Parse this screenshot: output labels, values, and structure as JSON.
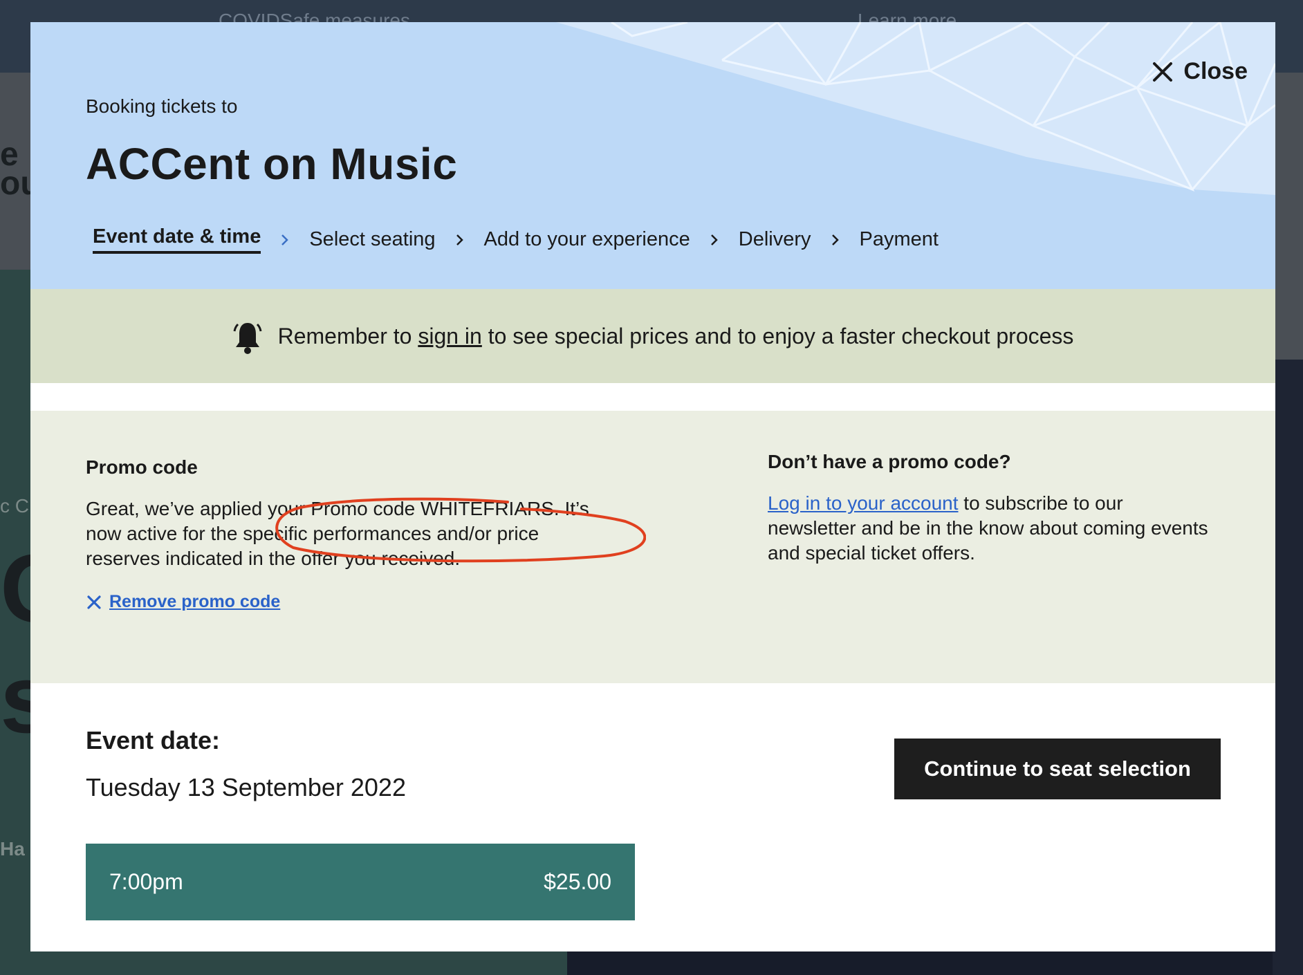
{
  "background": {
    "topbar_left": "COVIDSafe measures",
    "topbar_right": "Learn more",
    "fragment_1": "e",
    "fragment_2": "ou",
    "fragment_3": "c C",
    "fragment_4": "C",
    "fragment_5": "si",
    "fragment_6": "Ha"
  },
  "modal": {
    "close_label": "Close",
    "booking_label": "Booking tickets to",
    "event_title": "ACCent on Music",
    "steps": [
      {
        "label": "Event date & time",
        "active": true
      },
      {
        "label": "Select seating",
        "active": false
      },
      {
        "label": "Add to your experience",
        "active": false
      },
      {
        "label": "Delivery",
        "active": false
      },
      {
        "label": "Payment",
        "active": false
      }
    ],
    "signin_bar": {
      "prefix": "Remember to",
      "link": "sign in",
      "suffix": "to see special prices and to enjoy a faster checkout process",
      "icon": "bell-icon"
    },
    "promo": {
      "heading": "Promo code",
      "message": "Great, we’ve applied your Promo code WHITEFRIARS. It’s now active for the specific performances and/or price reserves indicated in the offer you received.",
      "remove_label": "Remove promo code"
    },
    "no_promo": {
      "heading": "Don’t have a promo code?",
      "link": "Log in to your account",
      "text": "to subscribe to our newsletter and be in the know about coming events and special ticket offers."
    },
    "event_date": {
      "label": "Event date:",
      "value": "Tuesday 13 September 2022"
    },
    "time_slot": {
      "time": "7:00pm",
      "price": "$25.00"
    },
    "continue_label": "Continue to seat selection"
  },
  "colors": {
    "header_bg": "#bdd9f7",
    "signin_bg": "#d9e0c9",
    "promo_bg": "#ebeee2",
    "time_slot_bg": "#357570",
    "continue_bg": "#1e1e1e",
    "link_blue": "#2a62c9",
    "annotation_red": "#e0401f"
  }
}
